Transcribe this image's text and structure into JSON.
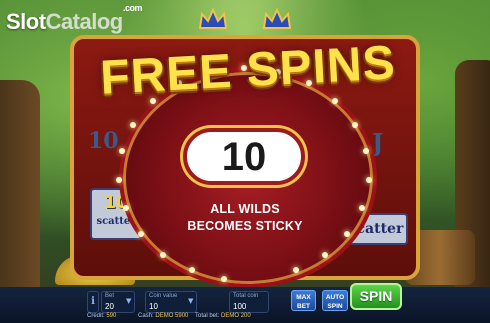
{
  "logo": {
    "part1": "Slot",
    "part2": "Catalog",
    "suffix": ".com"
  },
  "popup": {
    "title": "FREE SPINS",
    "count": "10",
    "message_line1": "ALL WILDS",
    "message_line2": "BECOMES STICKY"
  },
  "reel_symbols": {
    "left_value": "10",
    "left_label": "scatter",
    "right_label": "scatter",
    "top_left": "10",
    "top_right": "J"
  },
  "controls": {
    "info_label": "i",
    "bet_label": "Bet",
    "bet_value": "20",
    "coin_label": "Coin value",
    "coin_value": "10",
    "total_label": "Total coin",
    "total_value": "100",
    "max_bet_line1": "MAX",
    "max_bet_line2": "BET",
    "auto_line1": "AUTO",
    "auto_line2": "SPIN",
    "spin_label": "SPIN"
  },
  "footer": {
    "credit_label": "Credit:",
    "credit_value": "590",
    "cash_label": "Cash:",
    "cash_value": "DEMO 5900",
    "totalbet_label": "Total bet:",
    "totalbet_value": "DEMO 200"
  },
  "colors": {
    "title": "#ffe24a",
    "popup": "#7a0f15",
    "spin_button": "#229020",
    "control_bar": "#0a1428"
  }
}
